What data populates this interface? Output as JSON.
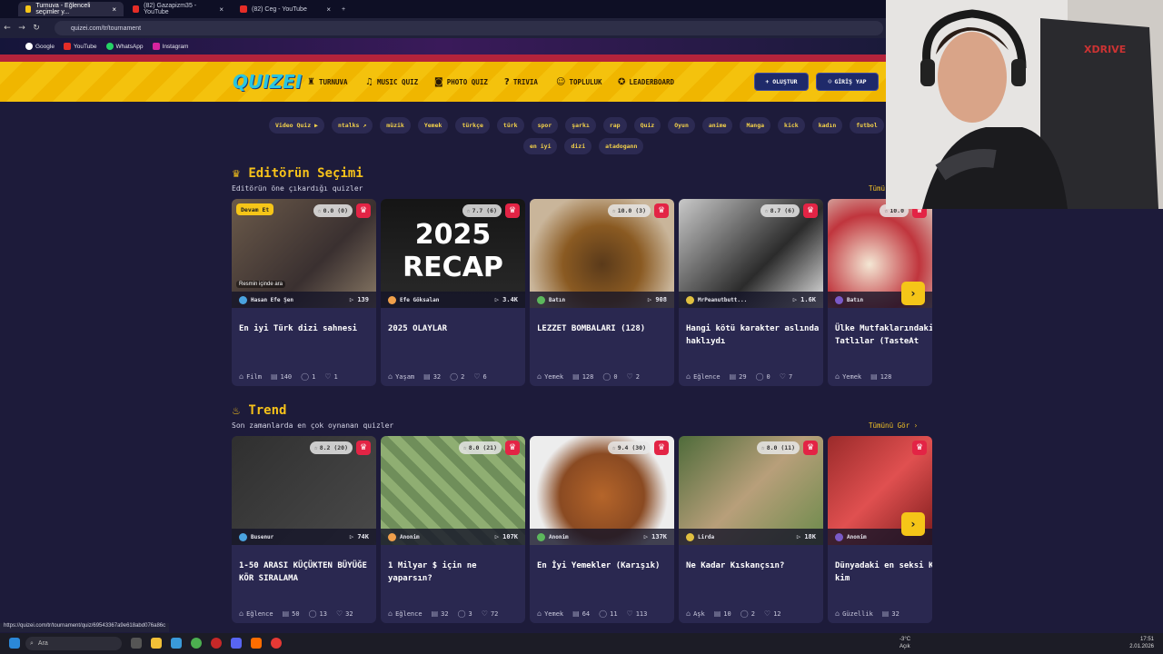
{
  "browser": {
    "tabs": [
      {
        "label": "Turnuva - Eğlenceli seçimler y..."
      },
      {
        "label": "(82) Gazapizm35 - YouTube"
      },
      {
        "label": "(82) Ceg - YouTube"
      }
    ],
    "url": "quizei.com/tr/tournament",
    "bookmarks": [
      "Google",
      "YouTube",
      "WhatsApp",
      "Instagram"
    ],
    "status_url": "https://quizei.com/tr/tournament/quiz/69543367a9e618abd076a86c"
  },
  "site": {
    "logo": "QUIZEI",
    "nav": [
      {
        "label": "TURNUVA",
        "icon": "trophy-icon"
      },
      {
        "label": "MUSIC QUIZ",
        "icon": "music-icon"
      },
      {
        "label": "PHOTO QUIZ",
        "icon": "camera-icon"
      },
      {
        "label": "TRIVIA",
        "icon": "question-icon"
      },
      {
        "label": "TOPLULUK",
        "icon": "users-icon"
      },
      {
        "label": "LEADERBOARD",
        "icon": "award-icon"
      }
    ],
    "create_button": "+ OLUŞTUR",
    "login_button": "GİRİŞ YAP"
  },
  "tags_row1": [
    "Video Quiz ▶",
    "ntalks ↗",
    "müzik",
    "Yemek",
    "türkçe",
    "türk",
    "spor",
    "şarkı",
    "rap",
    "Quiz",
    "Oyun",
    "anime",
    "Manga",
    "kick",
    "kadın",
    "futbol",
    "film"
  ],
  "tags_row2": [
    "en iyi",
    "dizi",
    "atadogann"
  ],
  "editors": {
    "title": "Editörün Seçimi",
    "subtitle": "Editörün öne çıkardığı quizler",
    "see_all": "Tümü",
    "cards": [
      {
        "title": "En iyi Türk dizi sahnesi",
        "rating": "0.0 (0)",
        "author": "Hasan Efe Şen",
        "plays": "139",
        "category": "Film",
        "questions": "140",
        "comments": "1",
        "likes": "1",
        "badge": "Devam Et",
        "overlay": "Resmin içinde ara"
      },
      {
        "title": "2025 OLAYLAR",
        "rating": "7.7 (6)",
        "author": "Efe Göksalan",
        "plays": "3.4K",
        "category": "Yaşam",
        "questions": "32",
        "comments": "2",
        "likes": "6",
        "thumb_text": "2025 RECAP"
      },
      {
        "title": "LEZZET BOMBALARI (128)",
        "rating": "10.0 (3)",
        "author": "Batın",
        "plays": "908",
        "category": "Yemek",
        "questions": "128",
        "comments": "0",
        "likes": "2"
      },
      {
        "title": "Hangi kötü karakter aslında haklıydı",
        "rating": "8.7 (6)",
        "author": "MrPeanutbutt...",
        "plays": "1.6K",
        "category": "Eğlence",
        "questions": "29",
        "comments": "0",
        "likes": "7"
      },
      {
        "title": "Ülke Mutfaklarındaki Tatlılar (TasteAt",
        "rating": "10.0",
        "author": "Batın",
        "plays": "",
        "category": "Yemek",
        "questions": "128",
        "comments": "",
        "likes": ""
      }
    ]
  },
  "trend": {
    "title": "Trend",
    "subtitle": "Son zamanlarda en çok oynanan quizler",
    "see_all": "Tümünü Gör ›",
    "cards": [
      {
        "title": "1-50 ARASI KÜÇÜKTEN BÜYÜĞE KÖR SIRALAMA",
        "rating": "8.2 (20)",
        "author": "Busenur",
        "plays": "74K",
        "category": "Eğlence",
        "questions": "50",
        "comments": "13",
        "likes": "32"
      },
      {
        "title": "1 Milyar $ için ne yaparsın?",
        "rating": "8.0 (21)",
        "author": "Anonim",
        "plays": "107K",
        "category": "Eğlence",
        "questions": "32",
        "comments": "3",
        "likes": "72"
      },
      {
        "title": "En İyi Yemekler (Karışık)",
        "rating": "9.4 (30)",
        "author": "Anonim",
        "plays": "137K",
        "category": "Yemek",
        "questions": "64",
        "comments": "11",
        "likes": "113"
      },
      {
        "title": "Ne Kadar Kıskançsın?",
        "rating": "8.0 (11)",
        "author": "Lirda",
        "plays": "18K",
        "category": "Aşk",
        "questions": "10",
        "comments": "2",
        "likes": "12"
      },
      {
        "title": "Dünyadaki en seksi Kadın kim",
        "rating": "",
        "author": "Anonim",
        "plays": "",
        "category": "Güzellik",
        "questions": "32",
        "comments": "",
        "likes": ""
      }
    ]
  },
  "taskbar": {
    "search_placeholder": "Ara",
    "weather_temp": "-3°C",
    "weather_desc": "Açık",
    "time": "17:51",
    "date": "2.01.2026"
  }
}
